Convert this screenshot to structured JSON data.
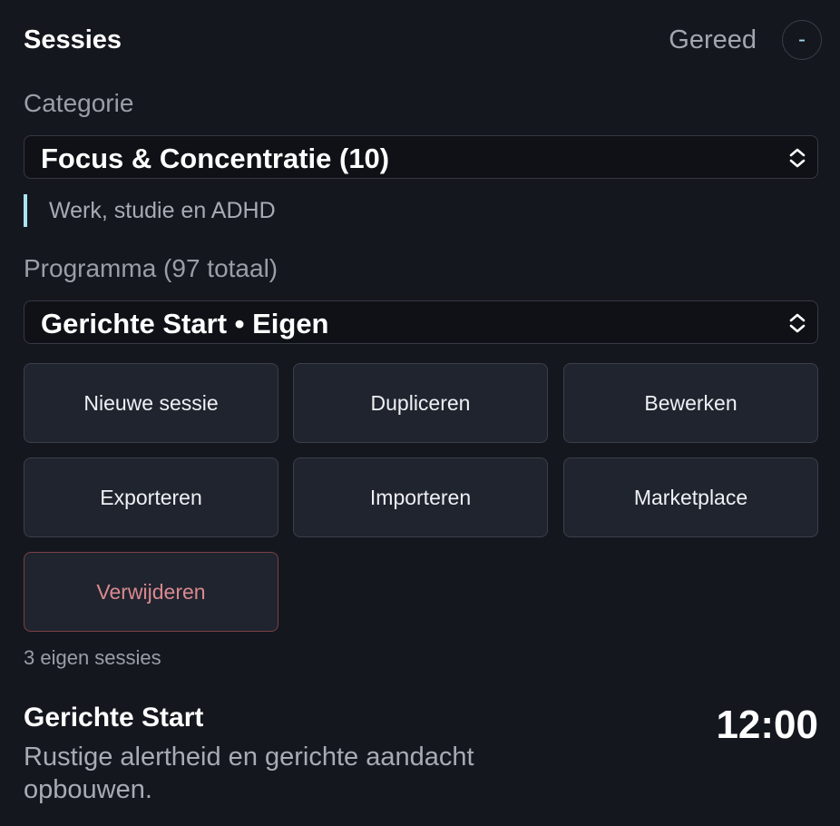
{
  "header": {
    "title": "Sessies",
    "status": "Gereed",
    "collapse_label": "-"
  },
  "category": {
    "label": "Categorie",
    "selected": "Focus & Concentratie (10)",
    "description": "Werk, studie en ADHD"
  },
  "program": {
    "label": "Programma (97 totaal)",
    "selected": "Gerichte Start • Eigen"
  },
  "actions": {
    "new": "Nieuwe sessie",
    "duplicate": "Dupliceren",
    "edit": "Bewerken",
    "export": "Exporteren",
    "import": "Importeren",
    "marketplace": "Marketplace",
    "delete": "Verwijderen"
  },
  "own_sessions_count": "3 eigen sessies",
  "session": {
    "title": "Gerichte Start",
    "description": "Rustige alertheid en gerichte aandacht opbouwen.",
    "duration": "12:00"
  },
  "colors": {
    "background": "#15171e",
    "accent": "#a9e3f5",
    "danger": "#d9898f"
  },
  "icons": {
    "collapse": "minus-icon",
    "select": "chevron-up-down-icon"
  }
}
